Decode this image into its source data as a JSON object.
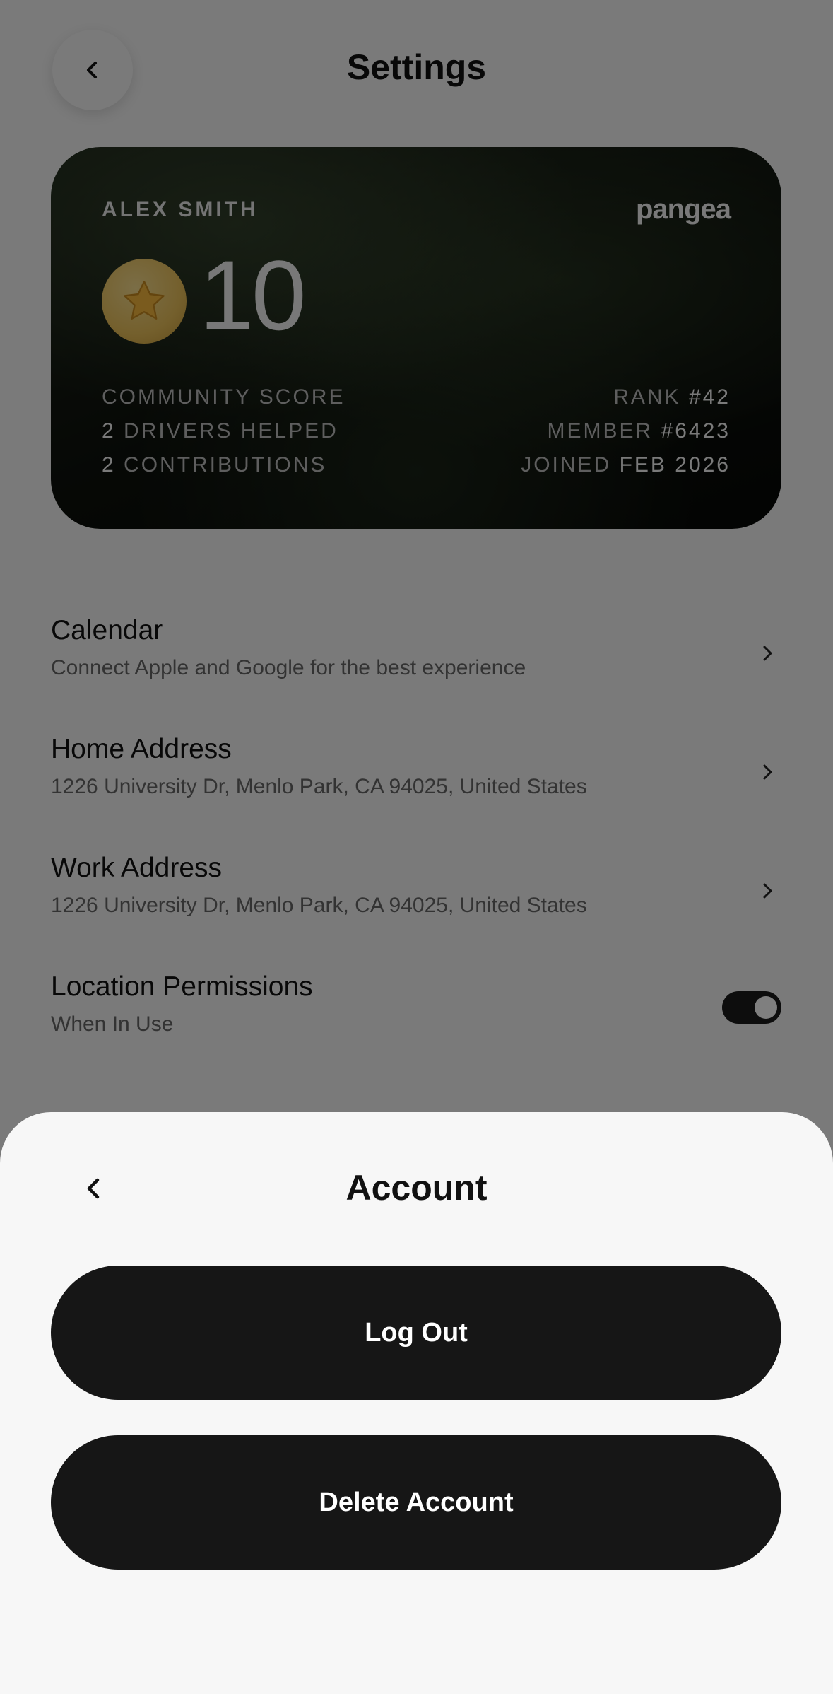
{
  "header": {
    "title": "Settings",
    "back_icon": "chevron-left-icon"
  },
  "card": {
    "name": "ALEX SMITH",
    "logo": "pangea",
    "score": "10",
    "badge_icon": "star-icon",
    "left_stats": [
      {
        "value": "",
        "label": "COMMUNITY SCORE"
      },
      {
        "value": "2",
        "label": "DRIVERS HELPED"
      },
      {
        "value": "2",
        "label": "CONTRIBUTIONS"
      }
    ],
    "right_stats": [
      {
        "label": "RANK",
        "value": "#42"
      },
      {
        "label": "MEMBER",
        "value": "#6423"
      },
      {
        "label": "JOINED",
        "value": "FEB 2026"
      }
    ]
  },
  "settings": {
    "calendar": {
      "title": "Calendar",
      "subtitle": "Connect Apple and Google for the best experience"
    },
    "home": {
      "title": "Home Address",
      "subtitle": "1226 University Dr, Menlo Park, CA  94025, United States"
    },
    "work": {
      "title": "Work Address",
      "subtitle": "1226 University Dr, Menlo Park, CA  94025, United States"
    },
    "location": {
      "title": "Location Permissions",
      "subtitle": "When In Use",
      "enabled": true
    }
  },
  "sheet": {
    "title": "Account",
    "logout_label": "Log Out",
    "delete_label": "Delete Account"
  },
  "colors": {
    "button": "#161616",
    "sheet": "#f7f7f7",
    "badge": "#e9c05a"
  }
}
